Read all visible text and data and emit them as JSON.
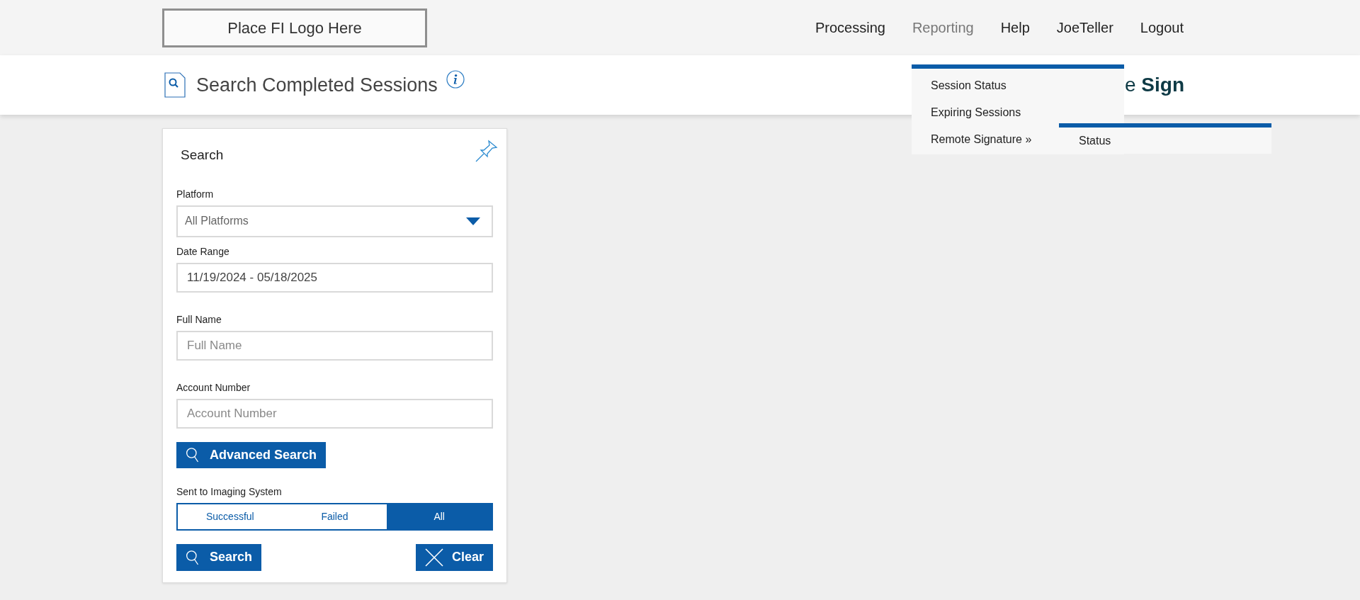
{
  "header": {
    "logo": "Place FI Logo Here",
    "nav": [
      {
        "label": "Processing",
        "selected": false
      },
      {
        "label": "Reporting",
        "selected": true
      },
      {
        "label": "Help",
        "selected": false
      },
      {
        "label": "JoeTeller",
        "selected": false
      },
      {
        "label": "Logout",
        "selected": false
      }
    ]
  },
  "title_bar": {
    "title": "Search Completed Sessions",
    "brand": "e **Sign**"
  },
  "dropdown": {
    "items": [
      {
        "label": "Session Status"
      },
      {
        "label": "Expiring Sessions"
      },
      {
        "label": "Remote Signature »"
      }
    ],
    "submenu": {
      "items": [
        {
          "label": "Status"
        }
      ]
    }
  },
  "search_panel": {
    "title": "Search",
    "platform": {
      "label": "Platform",
      "value": "All Platforms"
    },
    "date_range": {
      "label": "Date Range",
      "value": "11/19/2024 - 05/18/2025"
    },
    "full_name": {
      "label": "Full Name",
      "placeholder": "Full Name"
    },
    "account_number": {
      "label": "Account Number",
      "placeholder": "Account Number"
    },
    "advanced_button": "Advanced Search",
    "imaging": {
      "label": "Sent to Imaging System",
      "options": [
        {
          "label": "Successful",
          "selected": false
        },
        {
          "label": "Failed",
          "selected": false
        },
        {
          "label": "All",
          "selected": true
        }
      ]
    },
    "search_button": "Search",
    "clear_button": "Clear"
  }
}
